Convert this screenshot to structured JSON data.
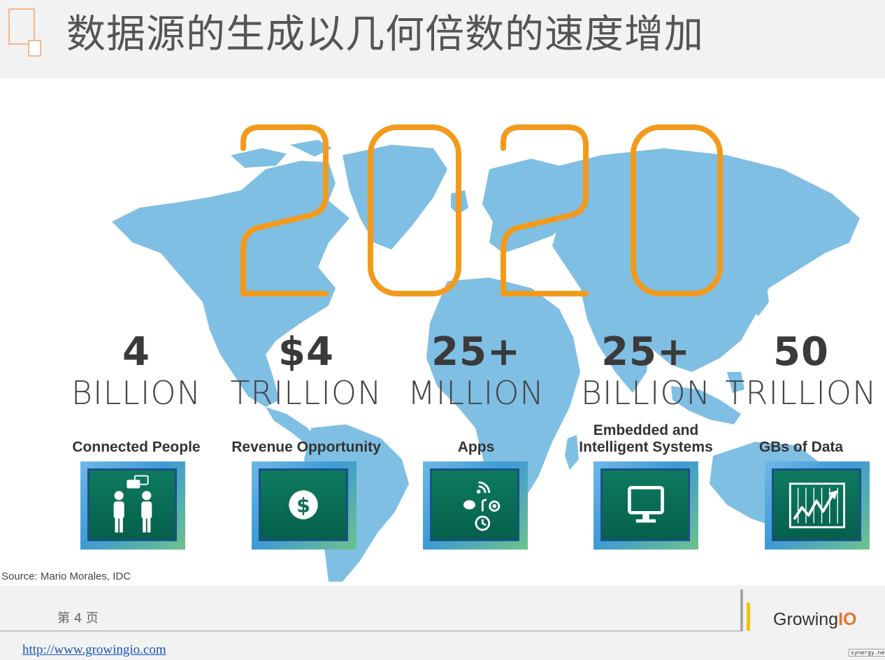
{
  "title": "数据源的生成以几何倍数的速度增加",
  "year": "2020",
  "stats": [
    {
      "number": "4",
      "unit": "BILLION",
      "caption": "Connected People",
      "icon": "people-chat-icon"
    },
    {
      "number": "$4",
      "unit": "TRILLION",
      "caption": "Revenue Opportunity",
      "icon": "dollar-coin-icon"
    },
    {
      "number": "25+",
      "unit": "MILLION",
      "caption": "Apps",
      "icon": "apps-cluster-icon"
    },
    {
      "number": "25+",
      "unit": "BILLION",
      "caption": "Embedded and Intelligent Systems",
      "icon": "monitor-icon"
    },
    {
      "number": "50",
      "unit": "TRILLION",
      "caption": "GBs of Data",
      "icon": "trend-chart-icon"
    }
  ],
  "source": "Source: Mario Morales, IDC",
  "footer": {
    "page": "第 4 页",
    "brand_main": "Growing",
    "brand_accent": "IO",
    "link": "http://www.growingio.com",
    "watermark": "synergy.net"
  },
  "colors": {
    "accent": "#f39a1d",
    "map": "#7fbfe3",
    "icon_green": "#0b6e55",
    "brand_io": "#e8702a"
  }
}
